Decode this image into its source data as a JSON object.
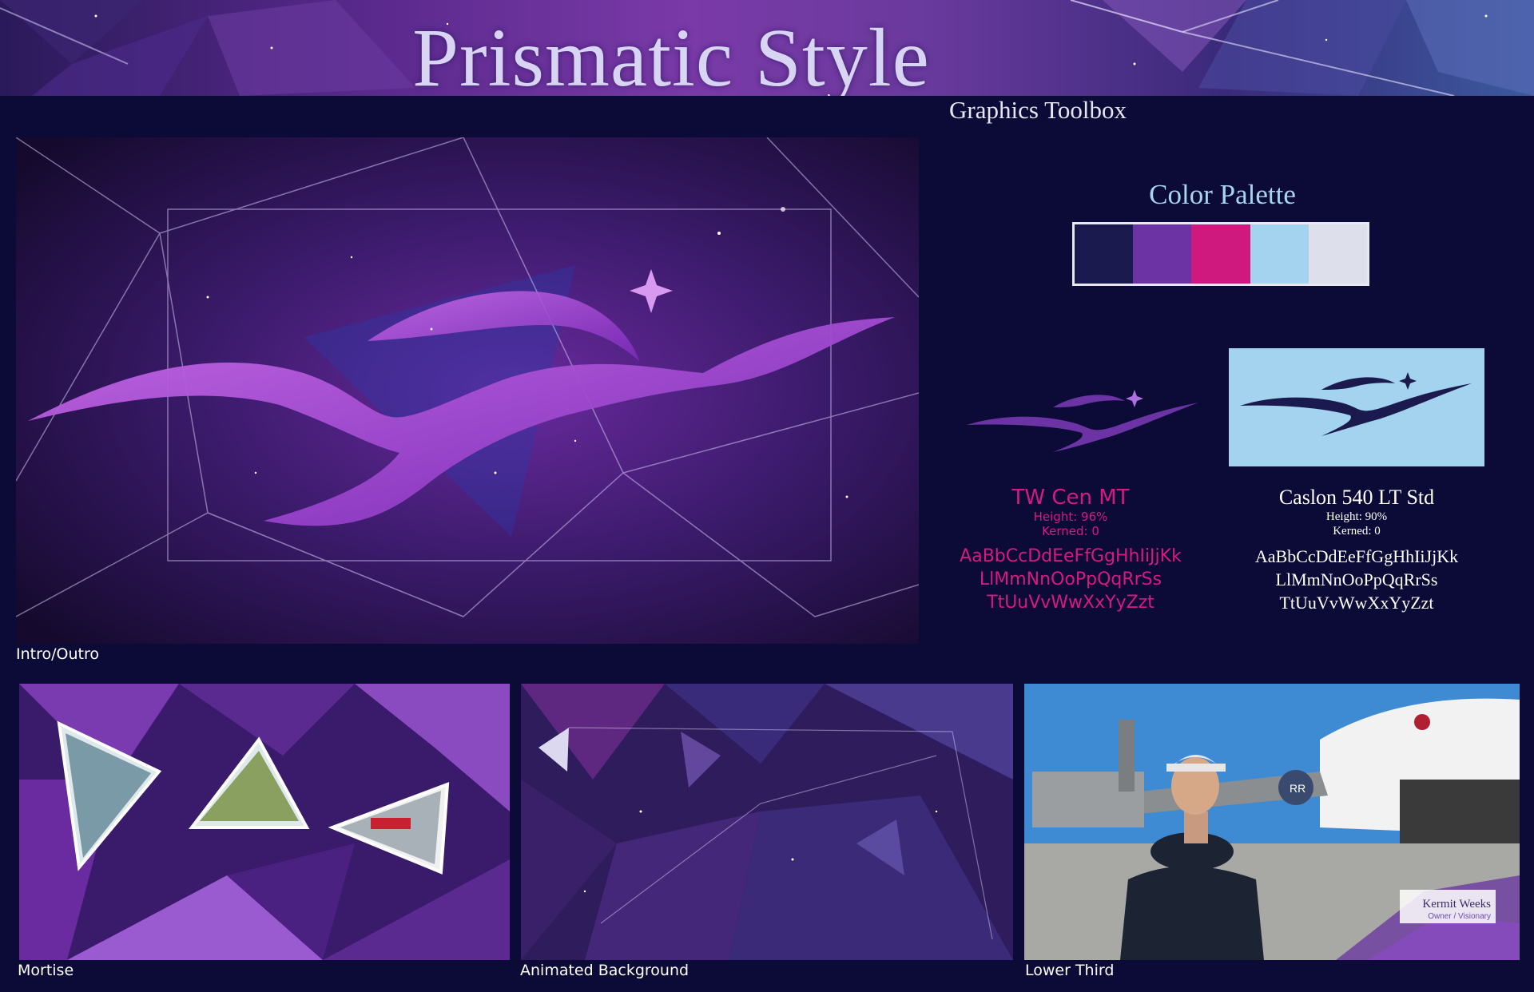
{
  "header": {
    "title": "Prismatic Style",
    "subtitle": "Graphics Toolbox"
  },
  "main_preview": {
    "caption": "Intro/Outro"
  },
  "palette": {
    "title": "Color Palette",
    "colors": [
      "#1a1a4e",
      "#6b33a3",
      "#d0197f",
      "#a4d3f0",
      "#dde0ea"
    ]
  },
  "fonts": [
    {
      "name": "TW Cen MT",
      "height": "Height: 96%",
      "kerned": "Kerned: 0",
      "sample": [
        "AaBbCcDdEeFfGgHhIiJjKk",
        "LlMmNnOoPpQqRrSs",
        "TtUuVvWwXxYyZzt"
      ]
    },
    {
      "name": "Caslon 540 LT Std",
      "height": "Height: 90%",
      "kerned": "Kerned: 0",
      "sample": [
        "AaBbCcDdEeFfGgHhIiJjKk",
        "LlMmNnOoPpQqRrSs",
        "TtUuVvWwXxYyZzt"
      ]
    }
  ],
  "thumbnails": [
    {
      "caption": "Mortise"
    },
    {
      "caption": "Animated Background"
    },
    {
      "caption": "Lower Third",
      "lower_third_name": "Kermit Weeks",
      "lower_third_title": "Owner / Visionary",
      "badge": "RR"
    }
  ]
}
